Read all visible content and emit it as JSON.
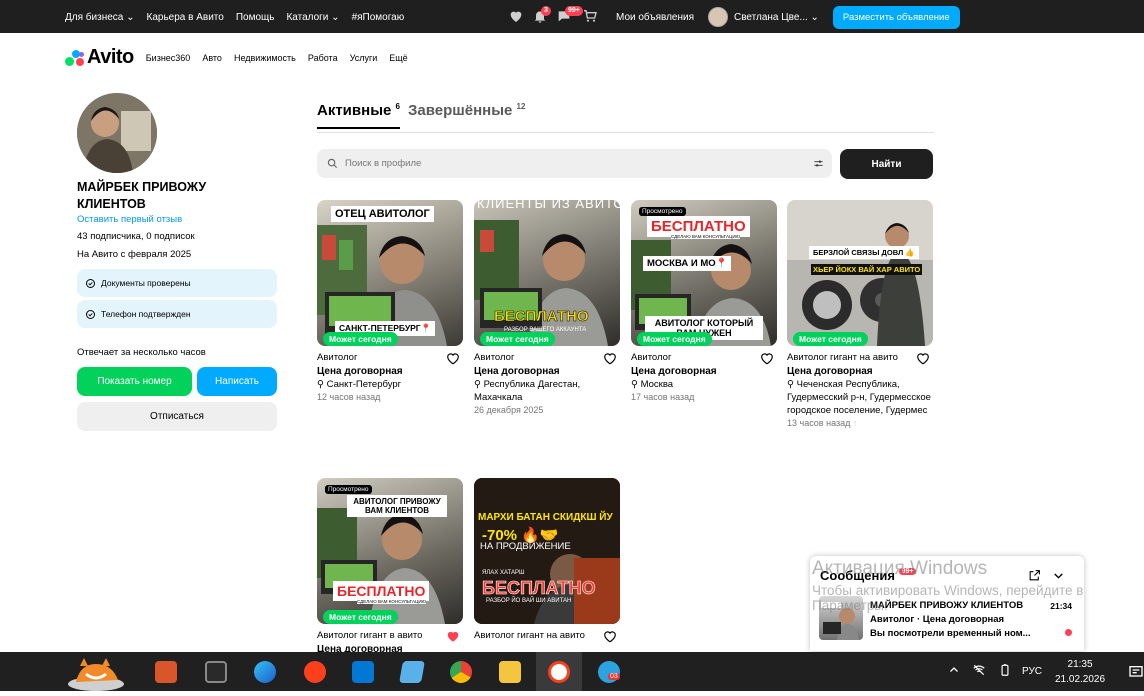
{
  "header": {
    "nav": [
      "Для бизнеса ⌄",
      "Карьера в Авито",
      "Помощь",
      "Каталоги ⌄",
      "#яПомогаю"
    ],
    "notif_badge": "3",
    "msg_badge": "99+",
    "my_ads": "Мои объявления",
    "user_name": "Светлана Цве... ⌄",
    "post_button": "Разместить объявление"
  },
  "logo": {
    "text": "Avito",
    "categories": [
      "Бизнес360",
      "Авто",
      "Недвижимость",
      "Работа",
      "Услуги",
      "Ещё"
    ]
  },
  "profile": {
    "name": "МАЙРБЕК ПРИВОЖУ КЛИЕНТОВ",
    "review_link": "Оставить первый отзыв",
    "subscribers": "43 подписчика, 0 подписок",
    "since": "На Авито с февраля 2025",
    "chips": [
      "Документы проверены",
      "Телефон подтвержден"
    ],
    "response": "Отвечает за несколько часов",
    "show_number": "Показать номер",
    "write": "Написать",
    "unsubscribe": "Отписаться"
  },
  "tabs": {
    "active_label": "Активные",
    "active_count": "6",
    "done_label": "Завершённые",
    "done_count": "12"
  },
  "search": {
    "placeholder": "Поиск в профиле",
    "button": "Найти"
  },
  "listings": [
    {
      "overlay_top": "ОТЕЦ АВИТОЛОГ",
      "overlay_bottom": "САНКТ-ПЕТЕРБУРГ📍",
      "badge": "Может сегодня",
      "title": "Авитолог",
      "price": "Цена договорная",
      "location": "Санкт-Петербург",
      "time": "12 часов назад"
    },
    {
      "overlay_top": "КЛИЕНТЫ ИЗ АВИТО",
      "overlay_mid": "БЕСПЛАТНО",
      "overlay_sub": "РАЗБОР ВАШЕГО АККАУНТА",
      "badge": "Может сегодня",
      "title": "Авитолог",
      "price": "Цена договорная",
      "location": "Республика Дагестан, Махачкала",
      "time": "26 декабря 2025"
    },
    {
      "viewed": "Просмотрено",
      "overlay_top": "БЕСПЛАТНО",
      "overlay_sub": "СДЕЛАЮ ВАМ КОНСУЛЬТАЦИЮ",
      "overlay_mid": "МОСКВА И МО📍",
      "overlay_bottom": "АВИТОЛОГ КОТОРЫЙ ВАМ НУЖЕН",
      "badge": "Может сегодня",
      "title": "Авитолог",
      "price": "Цена договорная",
      "location": "Москва",
      "time": "17 часов назад"
    },
    {
      "overlay_top": "БЕРЗЛОЙ СВЯЗЫ ДОВЛ 👍",
      "overlay_mid": "ХЬЕР ЙОКХ ВАЙ ХАР АВИТО",
      "badge": "Может сегодня",
      "title": "Авитолог гигант на авито",
      "price": "Цена договорная",
      "location": "Чеченская Республика, Гудермесский р-н, Гудермесское городское поселение, Гудермес",
      "time": "13 часов назад"
    },
    {
      "viewed": "Просмотрено",
      "overlay_top": "АВИТОЛОГ ПРИВОЖУ ВАМ КЛИЕНТОВ",
      "overlay_bottom": "БЕСПЛАТНО",
      "overlay_sub": "СДЕЛАЮ ВАМ КОНСУЛЬТАЦИЮ",
      "badge": "Может сегодня",
      "title": "Авитолог гигант в авито",
      "price": "Цена договорная"
    },
    {
      "overlay_top": "МАРХИ БАТАН СКИДКШ ЙУ",
      "overlay_mid": "-70% 🔥🤝",
      "overlay_sub2": "НА ПРОДВИЖЕНИЕ",
      "overlay_bottom": "БЕСПЛАТНО",
      "overlay_small": "ЯЛАХ ХАТАРШ",
      "overlay_sub": "РАЗБОР ЙО ВАЙ ШИ АВИТАН",
      "title": "Авитолог гигант на авито"
    }
  ],
  "messages": {
    "title": "Сообщения",
    "badge": "99+",
    "name": "МАЙРБЕК ПРИВОЖУ КЛИЕНТОВ",
    "time": "21:34",
    "subject": "Авитолог · Цена договорная",
    "text": "Вы посмотрели временный ном..."
  },
  "windows": {
    "watermark_title": "Активация Windows",
    "watermark_text": "Чтобы активировать Windows, перейдите в Параметры.",
    "lang": "РУС",
    "time": "21:35",
    "date": "21.02.2026",
    "telegram_badge": "03"
  }
}
